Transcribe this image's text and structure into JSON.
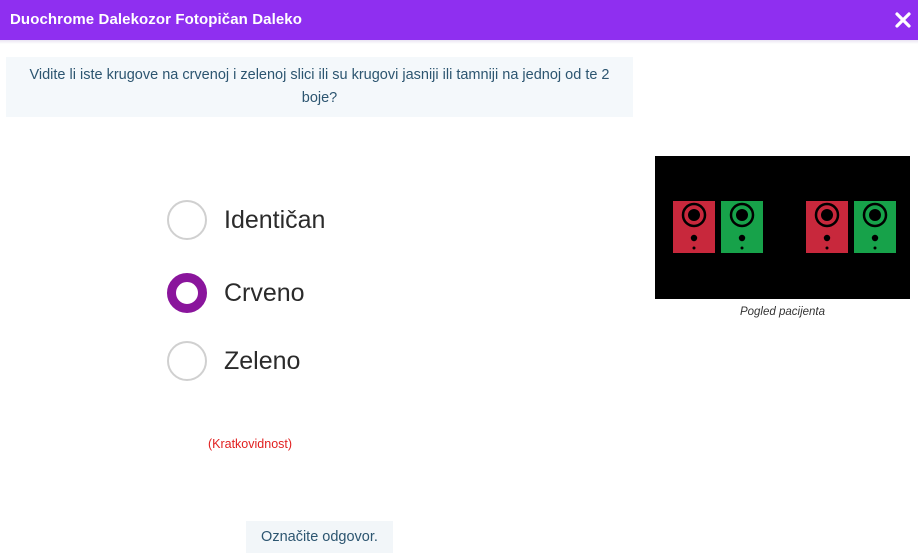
{
  "window": {
    "title": "Duochrome Dalekozor Fotopičan Daleko",
    "close_icon": "close-icon"
  },
  "question": "Vidite li iste krugove na crvenoj i zelenoj slici ili su krugovi jasniji ili tamniji na jednoj od te 2 boje?",
  "options": [
    {
      "label": "Identičan",
      "selected": false
    },
    {
      "label": "Crveno",
      "selected": true
    },
    {
      "label": "Zeleno",
      "selected": false
    }
  ],
  "hint": "(Kratkovidnost)",
  "prompt": "Označite odgovor.",
  "patient_view": {
    "caption": "Pogled pacijenta",
    "colors": {
      "red": "#c8283c",
      "green": "#17a24a",
      "background": "#000000"
    }
  },
  "colors": {
    "titlebar": "#8f2ff0",
    "radio_selected": "#8a159c",
    "hint": "#e11f1f",
    "question_text": "#2c5570"
  }
}
